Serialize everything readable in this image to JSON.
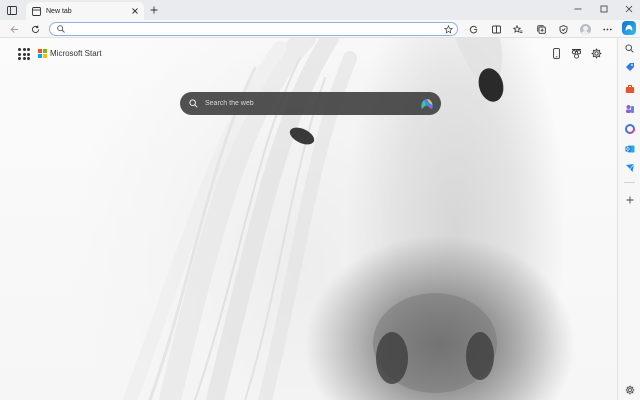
{
  "browser": {
    "tab": {
      "title": "New tab"
    },
    "address_bar": {
      "value": "",
      "placeholder": ""
    },
    "colors": {
      "accent": "#0f6fd9",
      "tabstrip": "#e9ebee",
      "toolbar": "#f7f7f7"
    }
  },
  "toolbar": {
    "left_icons": [
      "back-icon",
      "refresh-icon"
    ],
    "right_icons": [
      "star-add-icon",
      "extensions-icon",
      "split-screen-icon",
      "favorites-icon",
      "collections-icon",
      "browser-essentials-icon",
      "profile-avatar",
      "more-icon",
      "copilot-icon"
    ]
  },
  "page": {
    "brand": "Microsoft Start",
    "logo_colors": [
      "#f25022",
      "#7fba00",
      "#00a4ef",
      "#ffb900"
    ],
    "search": {
      "placeholder": "Search the web"
    },
    "top_right_icons": [
      "phone-icon",
      "rewards-icon",
      "settings-icon"
    ]
  },
  "sidebar": {
    "items": [
      "search-icon",
      "shopping-icon",
      "tools-icon",
      "games-icon",
      "microsoft365-icon",
      "outlook-icon",
      "drop-icon",
      "add-icon",
      "sidebar-settings-icon"
    ]
  }
}
